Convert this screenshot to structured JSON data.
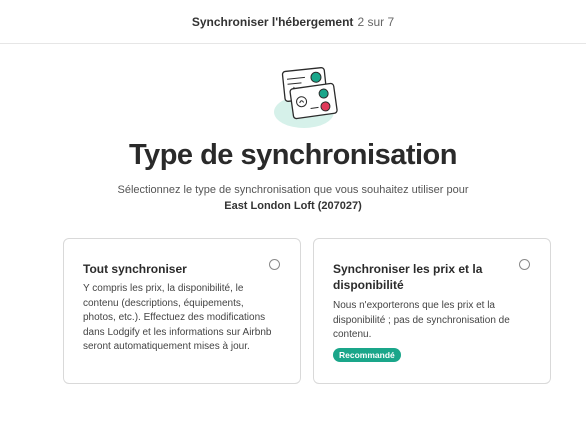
{
  "header": {
    "step_title": "Synchroniser l'hébergement",
    "step_count": "2 sur 7"
  },
  "page": {
    "title": "Type de synchronisation",
    "subtitle": "Sélectionnez le type de synchronisation que vous souhaitez utiliser pour",
    "listing_name": "East London Loft (207027)"
  },
  "options": [
    {
      "title": "Tout synchroniser",
      "description": "Y compris les prix, la disponibilité, le contenu (descriptions, équipements, photos, etc.). Effectuez des modifications dans Lodgify et les informations sur Airbnb seront automatiquement mises à jour.",
      "selected": false
    },
    {
      "title": "Synchroniser les prix et la disponibilité",
      "description": "Nous n'exporterons que les prix et la disponibilité ; pas de synchronisation de contenu.",
      "badge": "Recommandé",
      "selected": false
    }
  ],
  "colors": {
    "accent": "#1aa68a",
    "badge_bg": "#1aa68a",
    "illustration_bg": "#d6f1ea",
    "illustration_green": "#1aa68a",
    "illustration_red": "#e0395a"
  }
}
